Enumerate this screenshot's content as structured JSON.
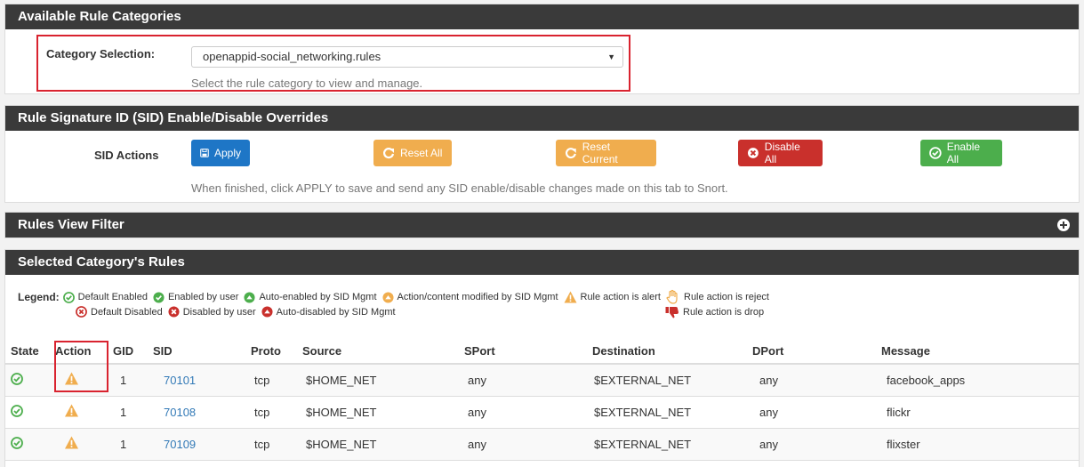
{
  "category_panel": {
    "title": "Available Rule Categories",
    "label": "Category Selection:",
    "selected": "openappid-social_networking.rules",
    "help": "Select the rule category to view and manage."
  },
  "sid_panel": {
    "title": "Rule Signature ID (SID) Enable/Disable Overrides",
    "label": "SID Actions",
    "buttons": {
      "apply": "Apply",
      "reset_all": "Reset All",
      "reset_current": "Reset Current",
      "disable_all": "Disable All",
      "enable_all": "Enable All"
    },
    "help": "When finished, click APPLY to save and send any SID enable/disable changes made on this tab to Snort."
  },
  "filter_panel": {
    "title": "Rules View Filter"
  },
  "rules_panel": {
    "title": "Selected Category's Rules",
    "legend": {
      "label": "Legend:",
      "default_enabled": "Default Enabled",
      "enabled_by_user": "Enabled by user",
      "auto_enabled": "Auto-enabled by SID Mgmt",
      "action_modified": "Action/content modified by SID Mgmt",
      "action_alert": "Rule action is alert",
      "action_reject": "Rule action is reject",
      "default_disabled": "Default Disabled",
      "disabled_by_user": "Disabled by user",
      "auto_disabled": "Auto-disabled by SID Mgmt",
      "action_drop": "Rule action is drop"
    },
    "columns": [
      "State",
      "Action",
      "GID",
      "SID",
      "Proto",
      "Source",
      "SPort",
      "Destination",
      "DPort",
      "Message"
    ],
    "rows": [
      {
        "gid": "1",
        "sid": "70101",
        "proto": "tcp",
        "source": "$HOME_NET",
        "sport": "any",
        "destination": "$EXTERNAL_NET",
        "dport": "any",
        "message": "facebook_apps"
      },
      {
        "gid": "1",
        "sid": "70108",
        "proto": "tcp",
        "source": "$HOME_NET",
        "sport": "any",
        "destination": "$EXTERNAL_NET",
        "dport": "any",
        "message": "flickr"
      },
      {
        "gid": "1",
        "sid": "70109",
        "proto": "tcp",
        "source": "$HOME_NET",
        "sport": "any",
        "destination": "$EXTERNAL_NET",
        "dport": "any",
        "message": "flixster"
      }
    ]
  },
  "colors": {
    "header_bg": "#3a3a3a",
    "primary": "#1e76c6",
    "warning": "#f0ad4e",
    "danger": "#c9302c",
    "success": "#4cae4c",
    "highlight": "#d9232f"
  }
}
